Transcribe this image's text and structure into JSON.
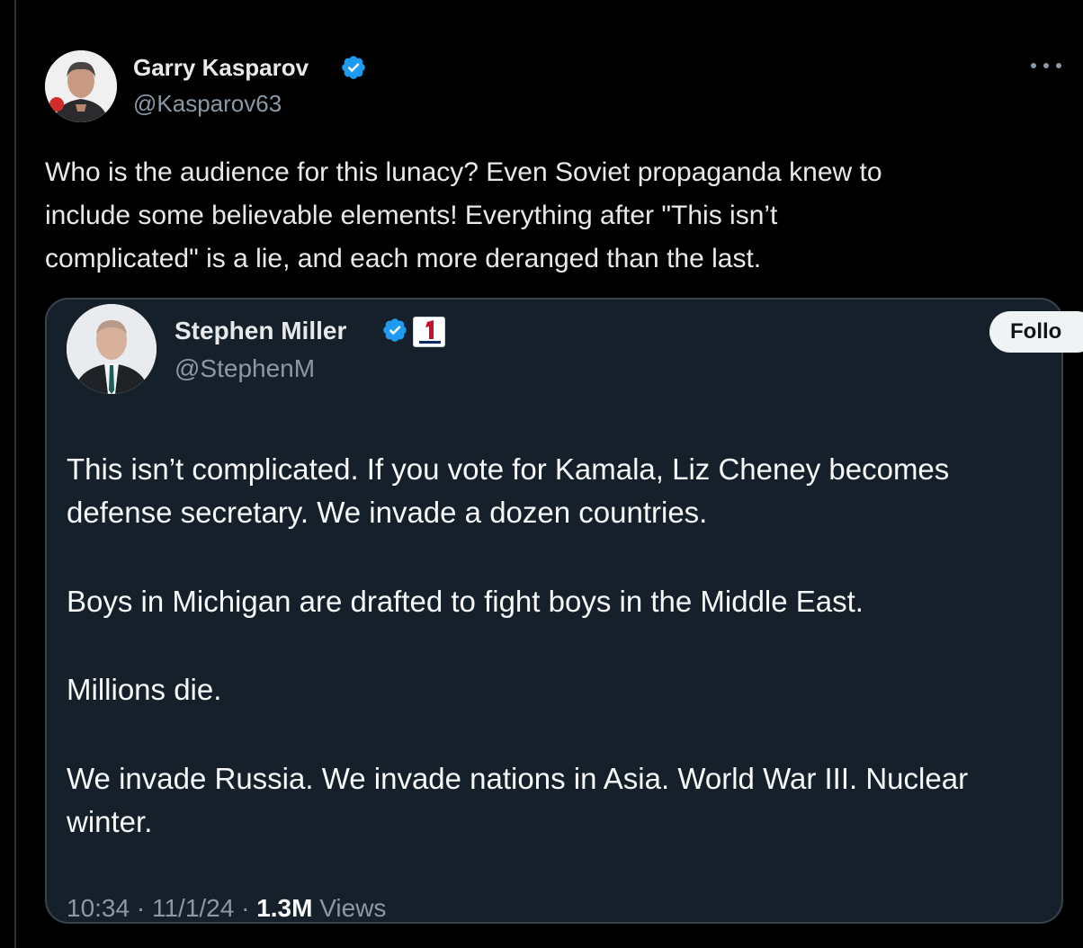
{
  "tweet": {
    "author": {
      "name": "Garry Kasparov",
      "handle": "@Kasparov63",
      "verified": true
    },
    "text_lines": [
      "Who is the audience for this lunacy? Even Soviet propaganda knew to",
      "include some believable elements! Everything after \"This isn’t",
      "complicated\" is a lie, and each more deranged than the last."
    ],
    "more_icon": "more-horizontal-icon"
  },
  "quote": {
    "author": {
      "name": "Stephen Miller",
      "handle": "@StephenM",
      "verified": true
    },
    "follow_label": "Follo",
    "paragraphs": [
      "This isn’t complicated. If you vote for Kamala, Liz Cheney becomes defense secretary. We invade a dozen countries.",
      "Boys in Michigan are drafted to fight boys in the Middle East.",
      "Millions die.",
      "We invade Russia. We invade nations in Asia. World War III. Nuclear winter."
    ],
    "time": "10:34",
    "date": "11/1/24",
    "views_count": "1.3M",
    "views_label": "Views"
  },
  "colors": {
    "background": "#000000",
    "card_background": "#15202b",
    "verified_blue": "#1d9bf0",
    "secondary_text": "#8b98a5"
  }
}
